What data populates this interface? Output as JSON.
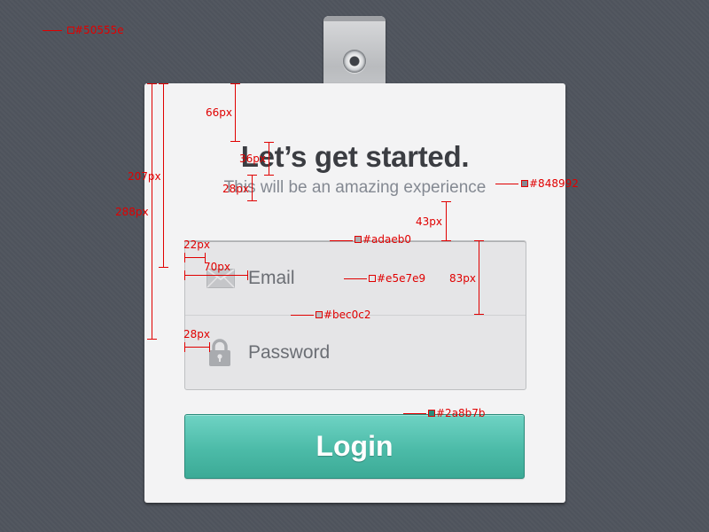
{
  "title": "Let’s get started.",
  "subtitle": "This will be an amazing experience",
  "fields": {
    "email": {
      "label": "Email",
      "icon": "envelope-icon"
    },
    "password": {
      "label": "Password",
      "icon": "lock-icon"
    }
  },
  "login_label": "Login",
  "colors": {
    "background": "#50555e",
    "subtitle": "#848992",
    "input_border_top": "#adaeb0",
    "input_fill": "#e5e7e9",
    "input_border": "#bec0c2",
    "button_border": "#2a8b7b"
  },
  "annotations": {
    "color_bg": "#50555e",
    "color_subtitle": "#848992",
    "color_input_top": "#adaeb0",
    "color_input_fill": "#e5e7e9",
    "color_input_border": "#bec0c2",
    "color_button": "#2a8b7b",
    "m66": "66px",
    "m36": "36px",
    "m28a": "28px",
    "m207": "207px",
    "m288": "288px",
    "m43": "43px",
    "m22": "22px",
    "m70": "70px",
    "m83": "83px",
    "m28b": "28px"
  }
}
